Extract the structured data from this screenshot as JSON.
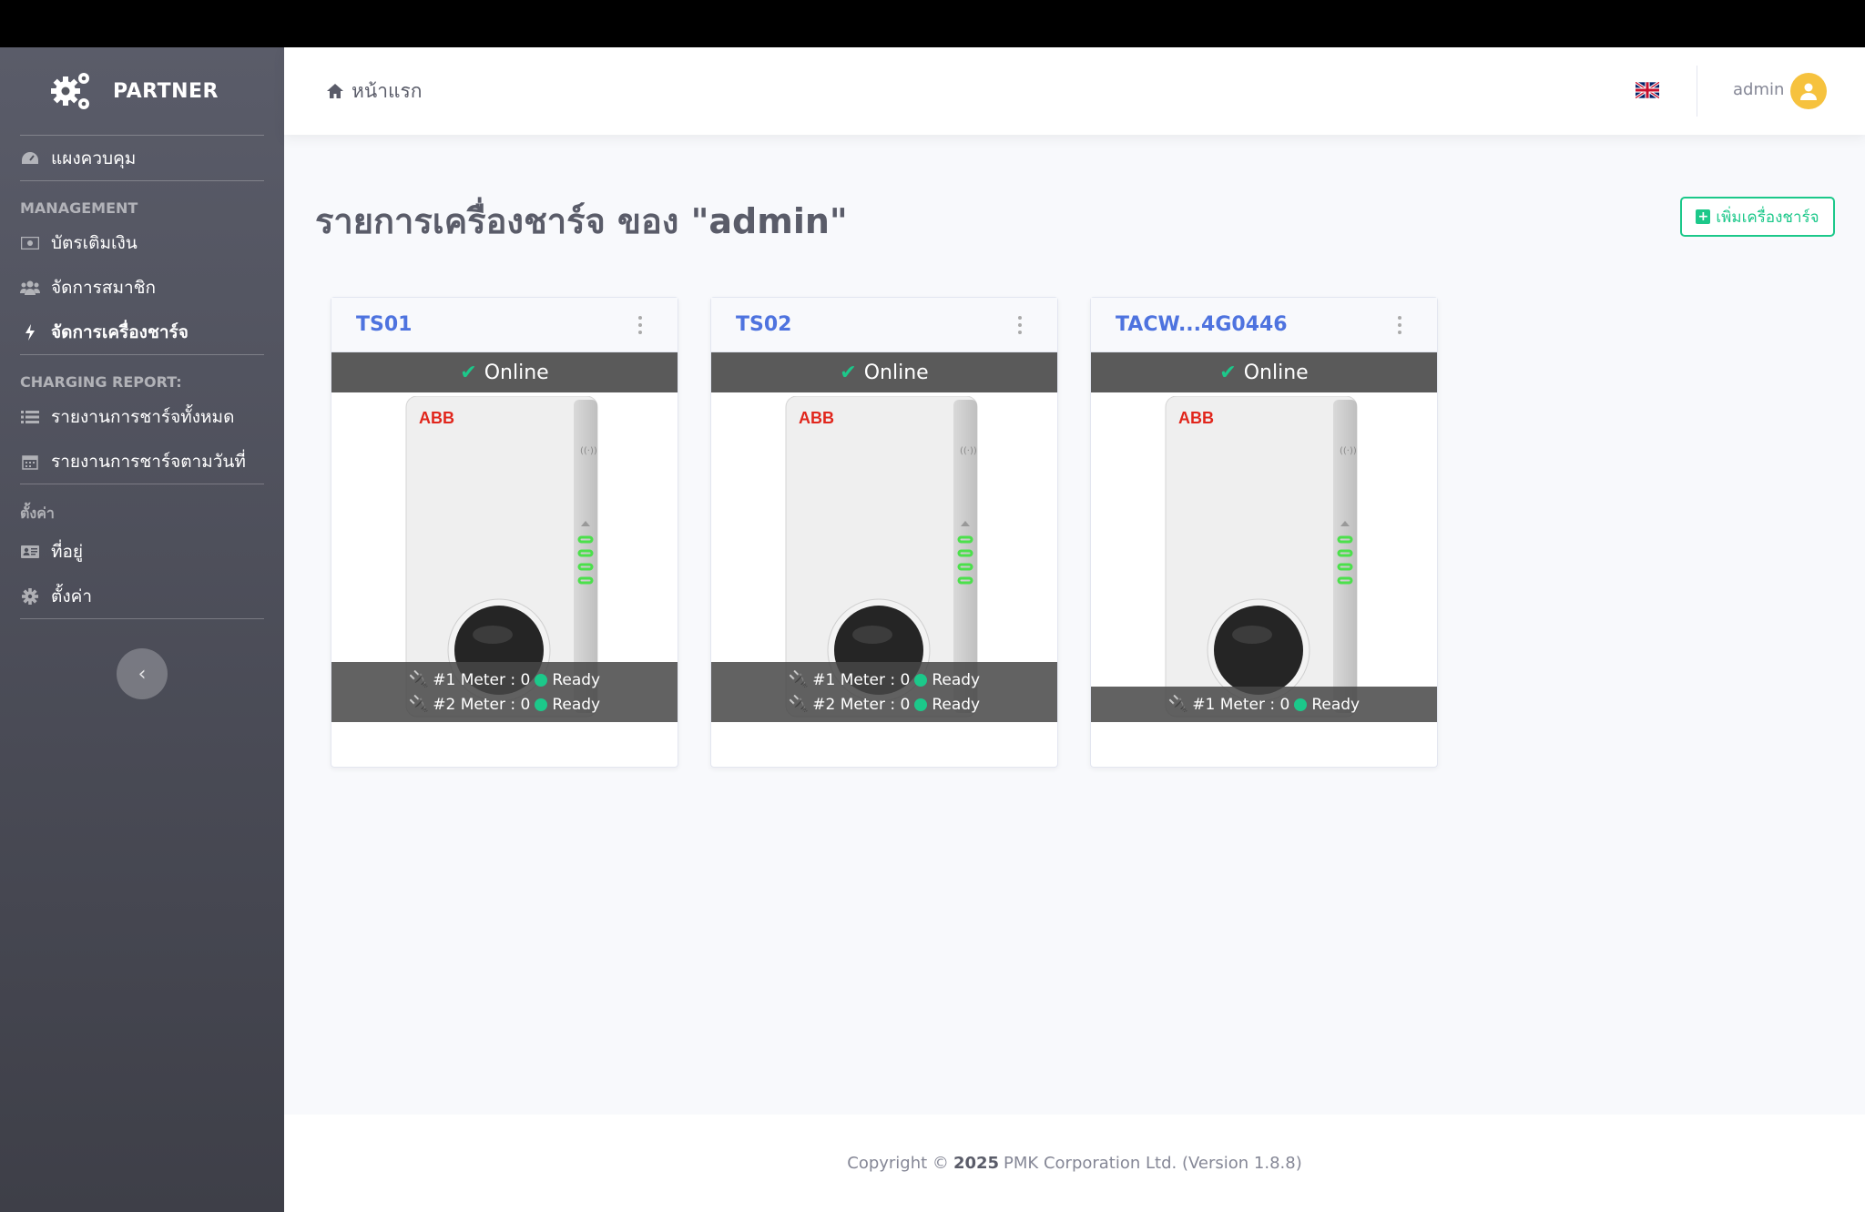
{
  "brand": {
    "name": "PARTNER"
  },
  "sidebar": {
    "dashboard": "แผงควบคุม",
    "management_head": "MANAGEMENT",
    "management_items": [
      {
        "label": "บัตรเติมเงิน",
        "icon": "money-card-icon"
      },
      {
        "label": "จัดการสมาชิก",
        "icon": "users-icon"
      },
      {
        "label": "จัดการเครื่องชาร์จ",
        "icon": "bolt-icon"
      }
    ],
    "report_head": "CHARGING REPORT:",
    "report_items": [
      {
        "label": "รายงานการชาร์จทั้งหมด",
        "icon": "list-icon"
      },
      {
        "label": "รายงานการชาร์จตามวันที่",
        "icon": "calendar-icon"
      }
    ],
    "settings_head": "ตั้งค่า",
    "settings_items": [
      {
        "label": "ที่อยู่",
        "icon": "address-card-icon"
      },
      {
        "label": "ตั้งค่า",
        "icon": "cog-icon"
      }
    ],
    "toggle": "‹"
  },
  "header": {
    "breadcrumb": "หน้าแรก",
    "username": "admin"
  },
  "page": {
    "title_prefix": "รายการเครื่องชาร์จ ของ ",
    "title_user": "\"admin\"",
    "add_button": "เพิ่มเครื่องชาร์จ"
  },
  "chargers": [
    {
      "name": "TS01",
      "status": "Online",
      "brand_logo": "ABB",
      "meters": [
        {
          "label": "#1 Meter : 0",
          "state": "Ready"
        },
        {
          "label": "#2 Meter : 0",
          "state": "Ready"
        }
      ]
    },
    {
      "name": "TS02",
      "status": "Online",
      "brand_logo": "ABB",
      "meters": [
        {
          "label": "#1 Meter : 0",
          "state": "Ready"
        },
        {
          "label": "#2 Meter : 0",
          "state": "Ready"
        }
      ]
    },
    {
      "name": "TACW...4G0446",
      "status": "Online",
      "brand_logo": "ABB",
      "meters": [
        {
          "label": "#1 Meter : 0",
          "state": "Ready"
        }
      ]
    }
  ],
  "footer": {
    "prefix": "Copyright ©",
    "year": "2025",
    "suffix": "PMK Corporation Ltd. (Version 1.8.8)"
  },
  "colors": {
    "accent": "#4e73df",
    "success": "#1cc88a",
    "warning": "#f6c23e"
  }
}
